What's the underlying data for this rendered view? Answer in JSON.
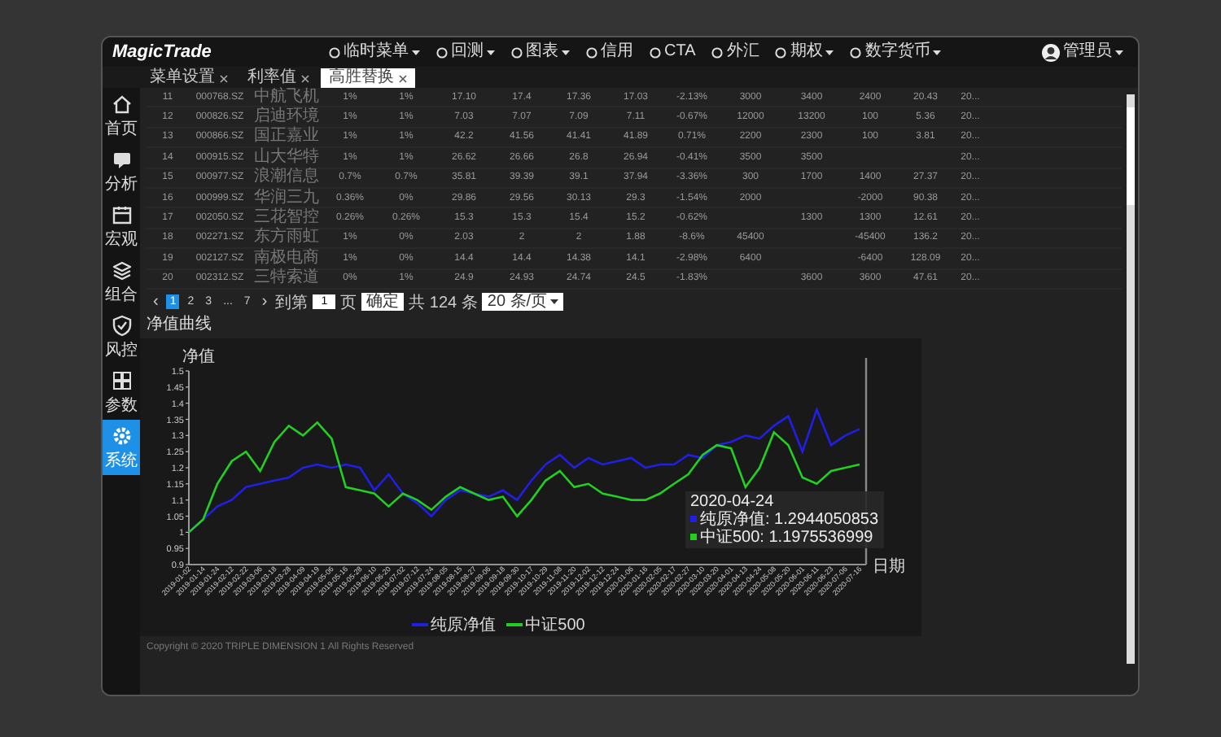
{
  "header": {
    "logo": "MagicTrade",
    "nav": [
      {
        "label": "临时菜单",
        "has_menu": true
      },
      {
        "label": "回测",
        "has_menu": true
      },
      {
        "label": "图表",
        "has_menu": true
      },
      {
        "label": "信用",
        "has_menu": false
      },
      {
        "label": "CTA",
        "has_menu": false
      },
      {
        "label": "外汇",
        "has_menu": false
      },
      {
        "label": "期权",
        "has_menu": true
      },
      {
        "label": "数字货币",
        "has_menu": true
      }
    ],
    "user": "管理员"
  },
  "tabs": [
    {
      "label": "菜单设置",
      "selected": false
    },
    {
      "label": "利率值",
      "selected": false
    },
    {
      "label": "高胜替换",
      "selected": true
    }
  ],
  "sidebar": {
    "items": [
      {
        "label": "首页",
        "selected": false
      },
      {
        "label": "分析",
        "selected": false
      },
      {
        "label": "宏观",
        "selected": false
      },
      {
        "label": "组合",
        "selected": false
      },
      {
        "label": "风控",
        "selected": false
      },
      {
        "label": "参数",
        "selected": false
      },
      {
        "label": "系统",
        "selected": true
      }
    ]
  },
  "table": {
    "rows": [
      [
        "11",
        "000768.SZ",
        "中航飞机",
        "1%",
        "1%",
        "17.10",
        "17.4",
        "17.36",
        "17.03",
        "-2.13%",
        "3000",
        "3400",
        "2400",
        "20.43",
        "20..."
      ],
      [
        "12",
        "000826.SZ",
        "启迪环境",
        "1%",
        "1%",
        "7.03",
        "7.07",
        "7.09",
        "7.11",
        "-0.67%",
        "12000",
        "13200",
        "100",
        "5.36",
        "20..."
      ],
      [
        "13",
        "000866.SZ",
        "国正嘉业",
        "1%",
        "1%",
        "42.2",
        "41.56",
        "41.41",
        "41.89",
        "0.71%",
        "2200",
        "2300",
        "100",
        "3.81",
        "20..."
      ],
      [
        "14",
        "000915.SZ",
        "山大华特",
        "1%",
        "1%",
        "26.62",
        "26.66",
        "26.8",
        "26.94",
        "-0.41%",
        "3500",
        "3500",
        "",
        "",
        "20..."
      ],
      [
        "15",
        "000977.SZ",
        "浪潮信息",
        "0.7%",
        "0.7%",
        "35.81",
        "39.39",
        "39.1",
        "37.94",
        "-3.36%",
        "300",
        "1700",
        "1400",
        "27.37",
        "20..."
      ],
      [
        "16",
        "000999.SZ",
        "华润三九",
        "0.36%",
        "0%",
        "29.86",
        "29.56",
        "30.13",
        "29.3",
        "-1.54%",
        "2000",
        "",
        "-2000",
        "90.38",
        "20..."
      ],
      [
        "17",
        "002050.SZ",
        "三花智控",
        "0.26%",
        "0.26%",
        "15.3",
        "15.3",
        "15.4",
        "15.2",
        "-0.62%",
        "",
        "1300",
        "1300",
        "12.61",
        "20..."
      ],
      [
        "18",
        "002271.SZ",
        "东方雨虹",
        "1%",
        "0%",
        "2.03",
        "2",
        "2",
        "1.88",
        "-8.6%",
        "45400",
        "",
        "-45400",
        "136.2",
        "20..."
      ],
      [
        "19",
        "002127.SZ",
        "南极电商",
        "1%",
        "0%",
        "14.4",
        "14.4",
        "14.38",
        "14.1",
        "-2.98%",
        "6400",
        "",
        "-6400",
        "128.09",
        "20..."
      ],
      [
        "20",
        "002312.SZ",
        "三特索道",
        "0%",
        "1%",
        "24.9",
        "24.93",
        "24.74",
        "24.5",
        "-1.83%",
        "",
        "3600",
        "3600",
        "47.61",
        "20..."
      ]
    ]
  },
  "pagination": {
    "prev": "‹",
    "next": "›",
    "pages": [
      {
        "label": "1",
        "selected": true
      },
      {
        "label": "2",
        "selected": false
      },
      {
        "label": "3",
        "selected": false
      },
      {
        "label": "...",
        "selected": false
      },
      {
        "label": "7",
        "selected": false
      }
    ],
    "goto_label": "到第",
    "goto_value": "1",
    "page_unit": "页",
    "confirm": "确定",
    "total": "共 124 条",
    "page_size": "20 条/页"
  },
  "chart_section": {
    "title": "净值曲线",
    "chart_data": {
      "type": "line",
      "ylabel": "净值",
      "xlabel": "日期",
      "ylim": [
        0.9,
        1.5
      ],
      "yticks": [
        0.9,
        0.95,
        1,
        1.05,
        1.1,
        1.15,
        1.2,
        1.25,
        1.3,
        1.35,
        1.4,
        1.45,
        1.5
      ],
      "categories": [
        "2019-01-02",
        "2019-01-14",
        "2019-01-24",
        "2019-02-12",
        "2019-02-22",
        "2019-03-06",
        "2019-03-18",
        "2019-03-28",
        "2019-04-09",
        "2019-04-19",
        "2019-05-06",
        "2019-05-16",
        "2019-05-28",
        "2019-06-10",
        "2019-06-20",
        "2019-07-02",
        "2019-07-12",
        "2019-07-24",
        "2019-08-05",
        "2019-08-15",
        "2019-08-27",
        "2019-09-06",
        "2019-09-18",
        "2019-09-30",
        "2019-10-17",
        "2019-10-29",
        "2019-11-08",
        "2019-11-20",
        "2019-12-02",
        "2019-12-12",
        "2019-12-24",
        "2020-01-06",
        "2020-01-16",
        "2020-02-05",
        "2020-02-17",
        "2020-02-27",
        "2020-03-10",
        "2020-03-20",
        "2020-04-01",
        "2020-04-13",
        "2020-04-24",
        "2020-05-08",
        "2020-05-20",
        "2020-06-01",
        "2020-06-11",
        "2020-06-23",
        "2020-07-06",
        "2020-07-16"
      ],
      "series": [
        {
          "name": "纯原净值",
          "color": "#1f1fe6",
          "values": [
            1.0,
            1.04,
            1.08,
            1.1,
            1.14,
            1.15,
            1.16,
            1.17,
            1.2,
            1.21,
            1.2,
            1.21,
            1.2,
            1.13,
            1.18,
            1.12,
            1.09,
            1.05,
            1.1,
            1.13,
            1.12,
            1.11,
            1.13,
            1.1,
            1.16,
            1.21,
            1.24,
            1.2,
            1.23,
            1.21,
            1.22,
            1.23,
            1.2,
            1.21,
            1.21,
            1.24,
            1.23,
            1.27,
            1.28,
            1.3,
            1.29,
            1.33,
            1.36,
            1.25,
            1.38,
            1.27,
            1.3,
            1.32
          ]
        },
        {
          "name": "中证500",
          "color": "#22d022",
          "values": [
            1.0,
            1.04,
            1.15,
            1.22,
            1.25,
            1.19,
            1.28,
            1.33,
            1.3,
            1.34,
            1.29,
            1.14,
            1.13,
            1.12,
            1.08,
            1.12,
            1.1,
            1.07,
            1.11,
            1.14,
            1.12,
            1.1,
            1.11,
            1.05,
            1.1,
            1.16,
            1.19,
            1.14,
            1.15,
            1.12,
            1.11,
            1.1,
            1.1,
            1.12,
            1.15,
            1.18,
            1.24,
            1.27,
            1.26,
            1.14,
            1.2,
            1.31,
            1.27,
            1.17,
            1.15,
            1.19,
            1.2,
            1.21
          ]
        }
      ]
    },
    "tooltip": {
      "date": "2020-04-24",
      "lines": [
        "纯原净值: 1.2944050853",
        "中证500: 1.1975536999"
      ]
    }
  },
  "footer": "Copyright © 2020 TRIPLE DIMENSION 1 All Rights Reserved"
}
